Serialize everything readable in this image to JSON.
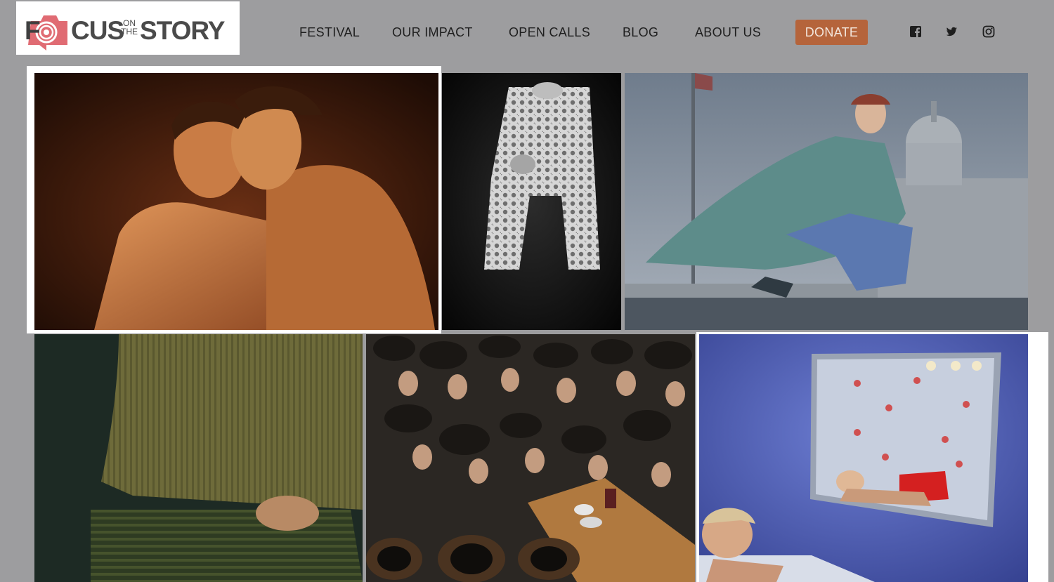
{
  "logo": {
    "letters_f": "F",
    "letters_cus": "CUS",
    "on": "ON",
    "the": "THE",
    "story": "STORY",
    "accent_color": "#e06b73"
  },
  "nav": {
    "items": [
      {
        "label": "FESTIVAL"
      },
      {
        "label": "OUR IMPACT"
      },
      {
        "label": "OPEN CALLS"
      },
      {
        "label": "BLOG"
      },
      {
        "label": "ABOUT US"
      }
    ],
    "donate": "DONATE",
    "donate_color": "#b5643b"
  },
  "social": {
    "icons": [
      "facebook-icon",
      "twitter-icon",
      "instagram-icon"
    ]
  },
  "gallery": {
    "photos": [
      {
        "name": "wrestlers-photo",
        "highlighted": true
      },
      {
        "name": "projected-pattern-photo",
        "highlighted": false
      },
      {
        "name": "nurse-city-hall-photo",
        "highlighted": false
      },
      {
        "name": "green-fabric-photo",
        "highlighted": false
      },
      {
        "name": "crowd-around-table-photo",
        "highlighted": false
      },
      {
        "name": "mirror-blue-room-photo",
        "highlighted": true
      }
    ]
  }
}
